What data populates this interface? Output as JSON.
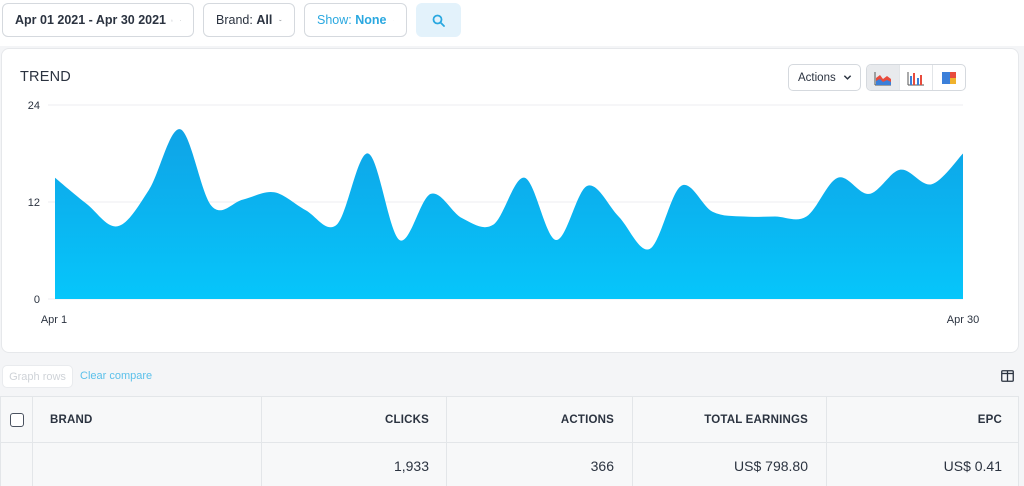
{
  "filters": {
    "date_range": "Apr 01 2021 - Apr 30 2021",
    "brand_label": "Brand:",
    "brand_value": "All",
    "show_label": "Show:",
    "show_value": "None"
  },
  "trend": {
    "title": "TREND",
    "actions_label": "Actions",
    "chart_views": [
      "area-chart-icon",
      "bar-chart-icon",
      "stacked-chart-icon"
    ],
    "active_view": "area-chart-icon"
  },
  "chart_data": {
    "type": "area",
    "x_tick_labels": [
      "Apr 1",
      "Apr 30"
    ],
    "y_tick_labels": [
      "24",
      "12",
      "0"
    ],
    "ylim": [
      0,
      24
    ],
    "grid": true,
    "color": "#0fb3ec",
    "values": [
      15,
      11.8,
      9,
      13.5,
      21,
      11.5,
      12.3,
      13.2,
      11,
      9.2,
      18,
      7.3,
      13,
      10,
      9.2,
      15,
      7.3,
      14,
      10.2,
      6.2,
      14,
      10.8,
      10.2,
      10.2,
      10.2,
      15,
      13,
      16,
      14.2,
      18
    ]
  },
  "table_controls": {
    "graph_rows_label": "Graph rows",
    "clear_compare_label": "Clear compare"
  },
  "table": {
    "columns": [
      "BRAND",
      "CLICKS",
      "ACTIONS",
      "TOTAL EARNINGS",
      "EPC"
    ],
    "rows": [
      {
        "brand": "",
        "clicks": "1,933",
        "actions": "366",
        "total_earnings": "US$ 798.80",
        "epc": "US$ 0.41"
      }
    ]
  },
  "colors": {
    "accent": "#2aa8e0",
    "area_top": "#0fa3e6",
    "area_bottom": "#06c6fb"
  }
}
